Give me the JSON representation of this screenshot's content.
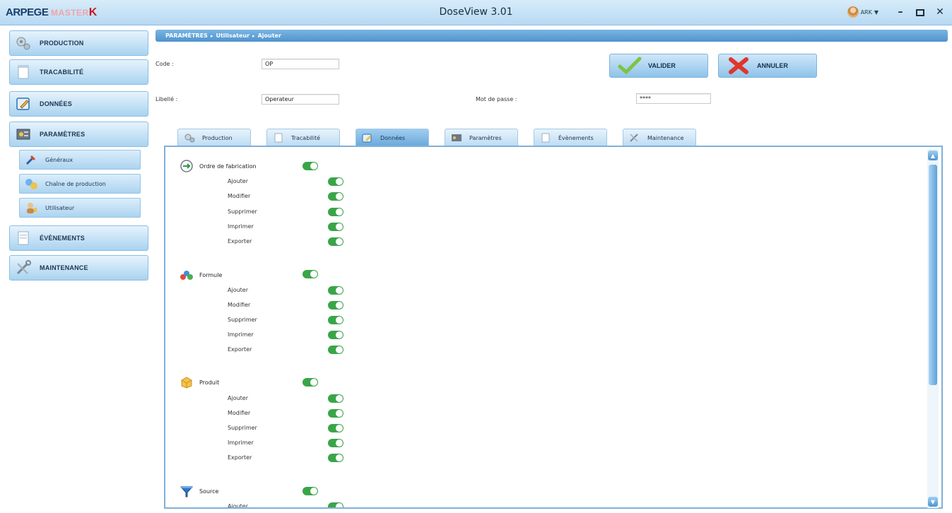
{
  "app": {
    "brand": {
      "part1": "ARPEGE",
      "part2": "MASTER",
      "part3": "K"
    },
    "title": "DoseView 3.01",
    "user": "ARK"
  },
  "sidebar": {
    "production": "PRODUCTION",
    "tracabilite": "TRACABILITÉ",
    "donnees": "DONNÉES",
    "parametres": "PARAMÈTRES",
    "sub": {
      "generaux": "Généraux",
      "chaine": "Chaîne de production",
      "utilisateur": "Utilisateur"
    },
    "evenements": "ÉVÈNEMENTS",
    "maintenance": "MAINTENANCE"
  },
  "breadcrumb": [
    "PARAMÈTRES",
    "Utilisateur",
    "Ajouter"
  ],
  "form": {
    "code_label": "Code :",
    "code_value": "OP",
    "libelle_label": "Libellé :",
    "libelle_value": "Operateur",
    "password_label": "Mot de passe :",
    "password_value": "****"
  },
  "actions": {
    "valider": "VALIDER",
    "annuler": "ANNULER"
  },
  "tabs": [
    "Production",
    "Tracabilité",
    "Données",
    "Paramètres",
    "Évènements",
    "Maintenance"
  ],
  "active_tab": "Données",
  "groups": [
    {
      "label": "Ordre de fabrication",
      "enabled": true,
      "perms": [
        "Ajouter",
        "Modifier",
        "Supprimer",
        "Imprimer",
        "Exporter"
      ]
    },
    {
      "label": "Formule",
      "enabled": true,
      "perms": [
        "Ajouter",
        "Modifier",
        "Supprimer",
        "Imprimer",
        "Exporter"
      ]
    },
    {
      "label": "Produit",
      "enabled": true,
      "perms": [
        "Ajouter",
        "Modifier",
        "Supprimer",
        "Imprimer",
        "Exporter"
      ]
    },
    {
      "label": "Source",
      "enabled": true,
      "perms": [
        "Ajouter"
      ]
    }
  ],
  "colors": {
    "toggle_on": "#3aa548",
    "accent": "#4f93cd",
    "brand_red": "#c61920"
  }
}
